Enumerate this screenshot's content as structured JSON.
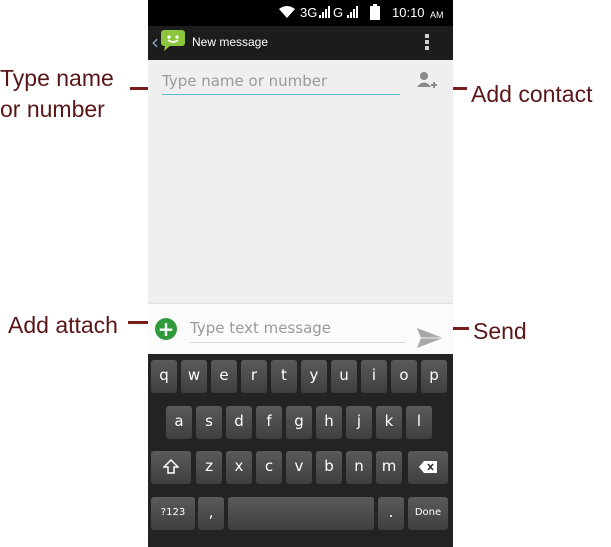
{
  "annotations": {
    "name_field": [
      "Type name",
      "or number"
    ],
    "add_contact": "Add contact",
    "add_attach": "Add attach",
    "send": "Send"
  },
  "status_bar": {
    "network": "3G",
    "network2": "G",
    "time": "10:10",
    "ampm": "AM"
  },
  "action_bar": {
    "title": "New message",
    "icons": [
      "back-chevron-icon",
      "messaging-app-icon",
      "overflow-menu-icon"
    ]
  },
  "compose": {
    "to_placeholder": "Type name or number",
    "to_value": "",
    "text_placeholder": "Type text message",
    "text_value": "",
    "icons": [
      "add-contact-icon",
      "attach-plus-icon",
      "send-icon"
    ]
  },
  "keyboard": {
    "row1": [
      "q",
      "w",
      "e",
      "r",
      "t",
      "y",
      "u",
      "i",
      "o",
      "p"
    ],
    "row2": [
      "a",
      "s",
      "d",
      "f",
      "g",
      "h",
      "j",
      "k",
      "l"
    ],
    "row3": [
      "z",
      "x",
      "c",
      "v",
      "b",
      "n",
      "m"
    ],
    "symbols": "?123",
    "comma": ",",
    "period": ".",
    "done": "Done"
  },
  "colors": {
    "callout": "#5a1616",
    "accent_underline": "#5fb6d6",
    "attach_green": "#2f9a3a",
    "status_bar": "#000000",
    "action_bar": "#1c1c1c",
    "keyboard_bg": "#232323"
  }
}
